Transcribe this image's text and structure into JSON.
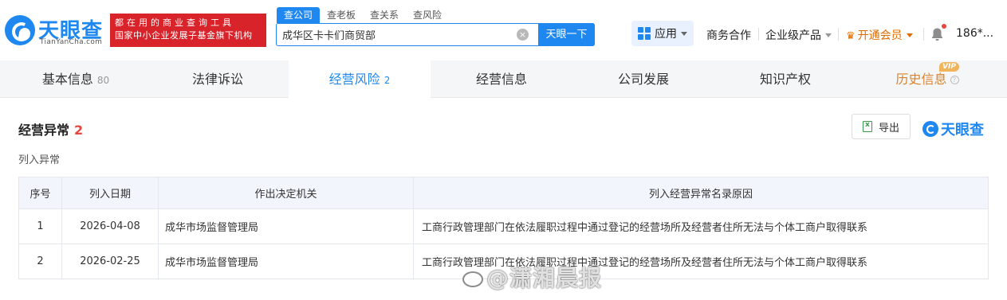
{
  "header": {
    "logo_text": "天眼查",
    "logo_sub": "TianYanCha.com",
    "slogan_line1": "都在用的商业查询工具",
    "slogan_line2": "国家中小企业发展子基金旗下机构",
    "search_tabs": [
      "查公司",
      "查老板",
      "查关系",
      "查风险"
    ],
    "search_value": "成华区卡卡们商贸部",
    "search_button": "天眼一下",
    "app_label": "应用",
    "nav": {
      "business": "商务合作",
      "enterprise": "企业级产品",
      "vip": "开通会员",
      "user": "186*..."
    }
  },
  "tabs": [
    {
      "label": "基本信息",
      "count": "80"
    },
    {
      "label": "法律诉讼",
      "count": ""
    },
    {
      "label": "经营风险",
      "count": "2"
    },
    {
      "label": "经营信息",
      "count": ""
    },
    {
      "label": "公司发展",
      "count": ""
    },
    {
      "label": "知识产权",
      "count": ""
    },
    {
      "label": "历史信息",
      "count": ""
    }
  ],
  "vip_badge": "VIP",
  "section": {
    "title": "经营异常",
    "count": "2",
    "export_label": "导出",
    "brand": "天眼查",
    "subtitle": "列入异常"
  },
  "table": {
    "headers": [
      "序号",
      "列入日期",
      "作出决定机关",
      "列入经营异常名录原因"
    ],
    "rows": [
      [
        "1",
        "2026-04-08",
        "成华市场监督管理局",
        "工商行政管理部门在依法履职过程中通过登记的经营场所及经营者住所无法与个体工商户取得联系"
      ],
      [
        "2",
        "2026-02-25",
        "成华市场监督管理局",
        "工商行政管理部门在依法履职过程中通过登记的经营场所及经营者住所无法与个体工商户取得联系"
      ]
    ]
  },
  "watermark": "@潇湘晨报",
  "colors": {
    "brand_blue": "#1e87f0",
    "slogan_red": "#d8232a",
    "count_red": "#e8453c",
    "vip_orange": "#e06c00"
  }
}
